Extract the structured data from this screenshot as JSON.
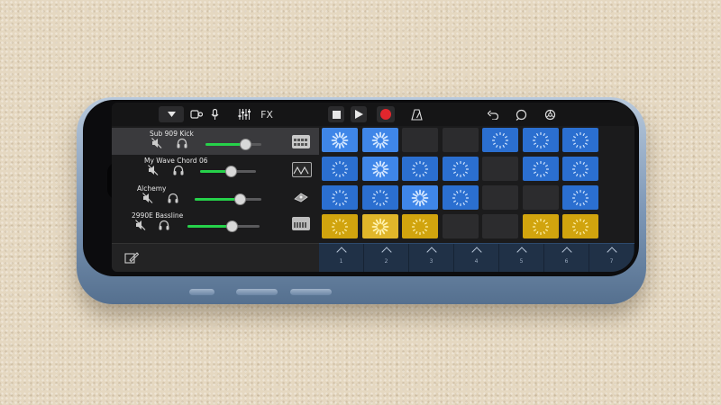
{
  "toolbar": {
    "browser_icon": "triangle-down-icon",
    "loop_icon": "loop-browser-icon",
    "mic_icon": "microphone-icon",
    "mixer_icon": "mixer-sliders-icon",
    "fx_label": "FX",
    "stop_icon": "stop-icon",
    "play_icon": "play-icon",
    "record_icon": "record-icon",
    "metronome_icon": "metronome-icon",
    "undo_icon": "undo-icon",
    "loop_settings_icon": "loop-circle-icon",
    "settings_icon": "gear-icon",
    "record_color": "#e3262d"
  },
  "tracks": [
    {
      "name": "Sub 909 Kick",
      "volume": 0.72,
      "instrument_icon": "drum-machine-icon",
      "selected": true
    },
    {
      "name": "My Wave Chord 06",
      "volume": 0.55,
      "instrument_icon": "synth-wave-icon",
      "selected": false
    },
    {
      "name": "Alchemy",
      "volume": 0.68,
      "instrument_icon": "alchemy-synth-icon",
      "selected": false
    },
    {
      "name": "2990E Bassline",
      "volume": 0.62,
      "instrument_icon": "bass-synth-icon",
      "selected": false
    }
  ],
  "grid": {
    "rows": [
      [
        "blue-active",
        "blue-active",
        "empty",
        "empty",
        "blue",
        "blue",
        "blue"
      ],
      [
        "blue",
        "blue-active",
        "blue",
        "blue",
        "empty",
        "blue",
        "blue"
      ],
      [
        "blue",
        "blue",
        "blue-active",
        "blue",
        "empty",
        "empty",
        "blue"
      ],
      [
        "yellow",
        "yellow-active",
        "yellow",
        "empty",
        "empty",
        "yellow",
        "yellow"
      ]
    ],
    "colors": {
      "blue": "#2b6fd0",
      "yellow": "#d1a40e",
      "empty": "#2c2c2e"
    }
  },
  "column_triggers": [
    "1",
    "2",
    "3",
    "4",
    "5",
    "6",
    "7"
  ],
  "footer": {
    "edit_icon": "cell-edit-icon"
  }
}
